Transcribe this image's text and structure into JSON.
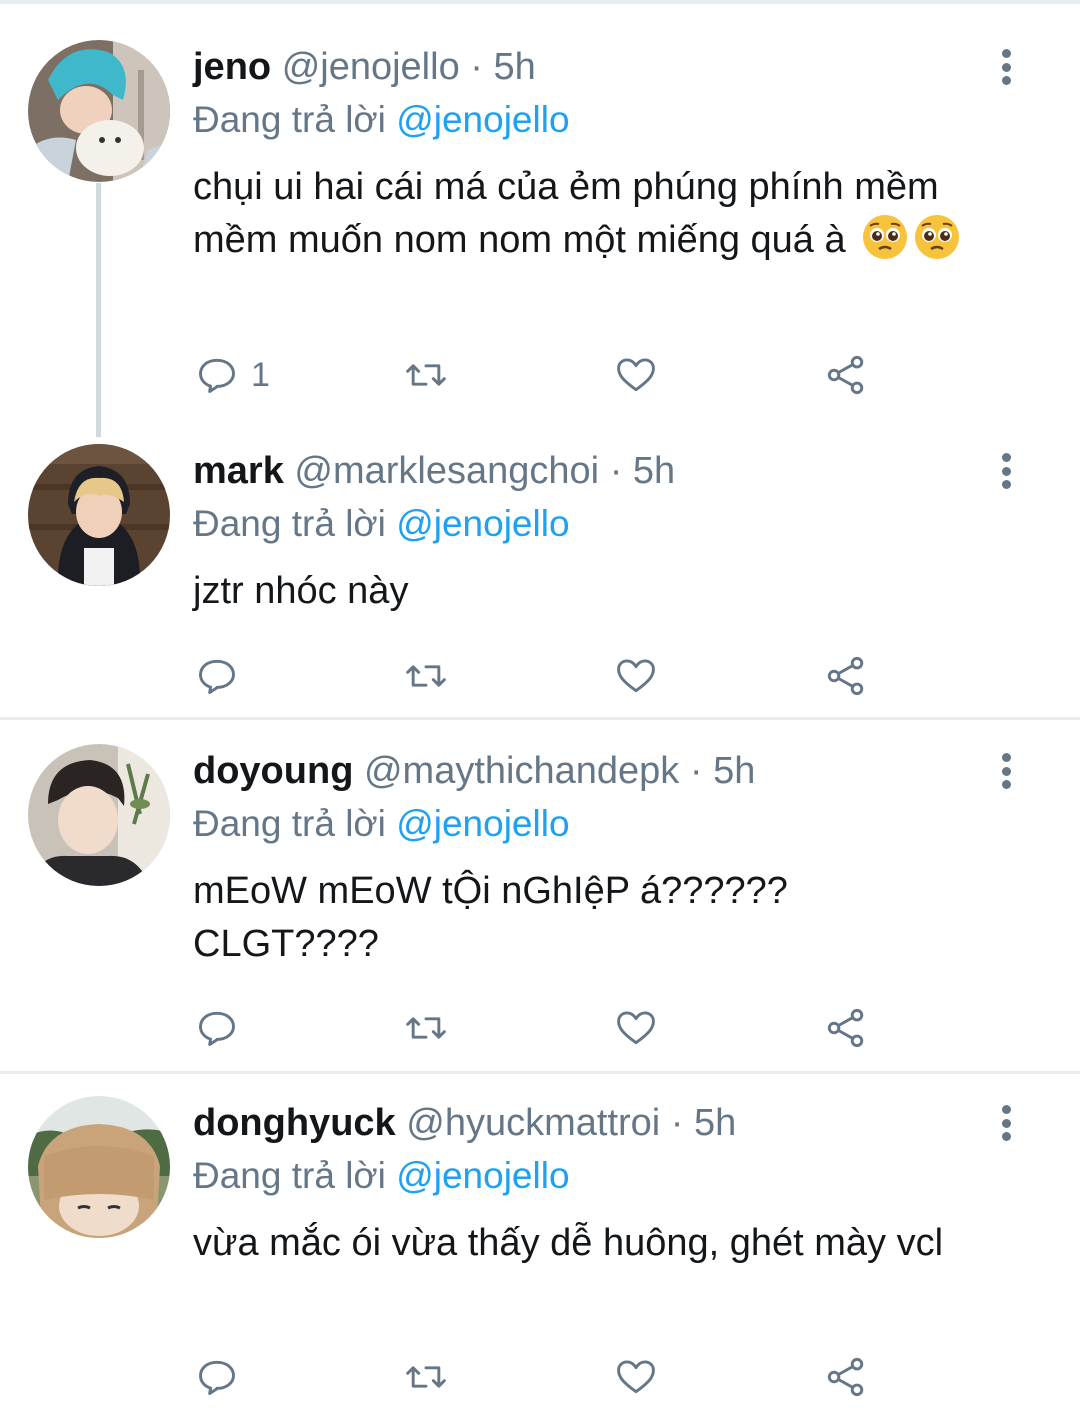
{
  "replies": [
    {
      "name": "jeno",
      "handle": "@jenojello",
      "dot": "·",
      "time": "5h",
      "reply_prefix": "Đang trả lời",
      "reply_to": "@jenojello",
      "text": "chụi ui hai cái má của ẻm phúng phính mềm mềm muốn nom nom một miếng quá à",
      "emoji": [
        "pleading-face-emoji",
        "pleading-face-emoji"
      ],
      "reply_count": "1"
    },
    {
      "name": "mark",
      "handle": "@marklesangchoi",
      "dot": "·",
      "time": "5h",
      "reply_prefix": "Đang trả lời",
      "reply_to": "@jenojello",
      "text": "jztr nhóc này"
    },
    {
      "name": "doyoung",
      "handle": "@maythichandepk",
      "dot": "·",
      "time": "5h",
      "reply_prefix": "Đang trả lời",
      "reply_to": "@jenojello",
      "text": "mEoW mEoW tỘi nGhIệP á?????? CLGT????"
    },
    {
      "name": "donghyuck",
      "handle": "@hyuckmattroi",
      "dot": "·",
      "time": "5h",
      "reply_prefix": "Đang trả lời",
      "reply_to": "@jenojello",
      "text": "vừa mắc ói vừa thấy dễ huông, ghét mày vcl"
    }
  ],
  "icons": {
    "reply": "reply-icon",
    "retweet": "retweet-icon",
    "like": "heart-icon",
    "share": "share-icon",
    "more": "more-vertical-icon"
  },
  "colors": {
    "name": "#14171a",
    "secondary": "#657786",
    "mention": "#1da1f2",
    "divider": "#e6ecf0"
  }
}
